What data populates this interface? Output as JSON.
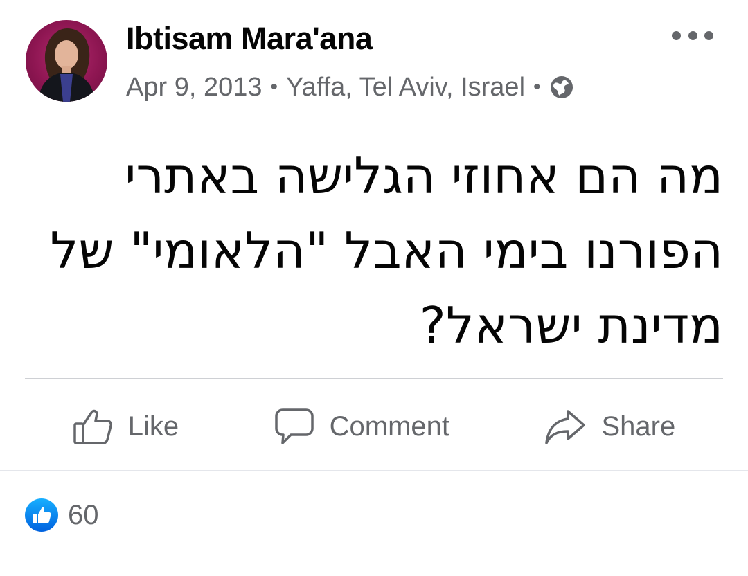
{
  "post": {
    "author_name": "Ibtisam Mara'ana",
    "date": "Apr 9, 2013",
    "separator": "•",
    "location": "Yaffa, Tel Aviv, Israel",
    "privacy_icon": "globe-icon",
    "text_lines": [
      "מה הם אחוזי הגלישה באתרי",
      "הפורנו בימי האבל \"הלאומי\" של",
      "מדינת ישראל?"
    ]
  },
  "actions": {
    "like_label": "Like",
    "comment_label": "Comment",
    "share_label": "Share"
  },
  "reactions": {
    "icon": "like-badge-icon",
    "count": "60"
  },
  "colors": {
    "text_primary": "#050505",
    "text_secondary": "#65676b",
    "like_blue": "#1877f2",
    "divider": "#ced0d4"
  }
}
